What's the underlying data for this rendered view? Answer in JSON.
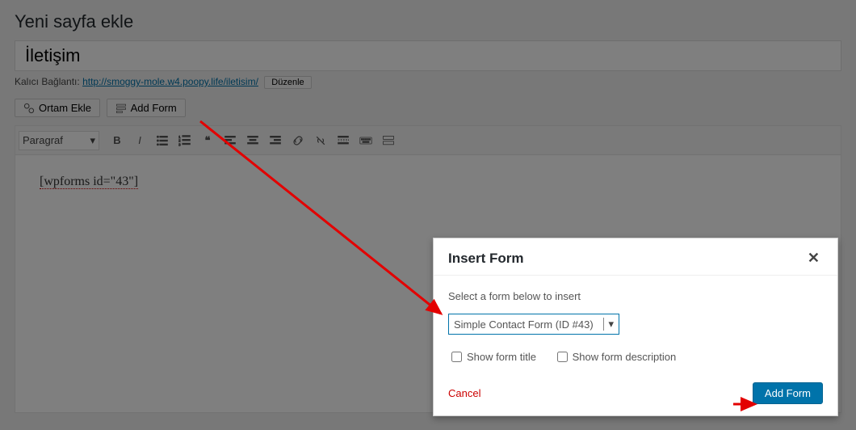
{
  "page": {
    "heading": "Yeni sayfa ekle",
    "title_value": "İletişim",
    "permalink_label": "Kalıcı Bağlantı:",
    "permalink_url": "http://smoggy-mole.w4.poopy.life/iletisim/",
    "permalink_edit": "Düzenle",
    "btn_media": "Ortam Ekle",
    "btn_addform": "Add Form",
    "toolbar": {
      "format": "Paragraf"
    },
    "content": "[wpforms id=\"43\"]"
  },
  "modal": {
    "title": "Insert Form",
    "instruction": "Select a form below to insert",
    "selected_form": "Simple Contact Form (ID #43)",
    "opt_show_title": "Show form title",
    "opt_show_desc": "Show form description",
    "cancel": "Cancel",
    "submit": "Add Form"
  }
}
